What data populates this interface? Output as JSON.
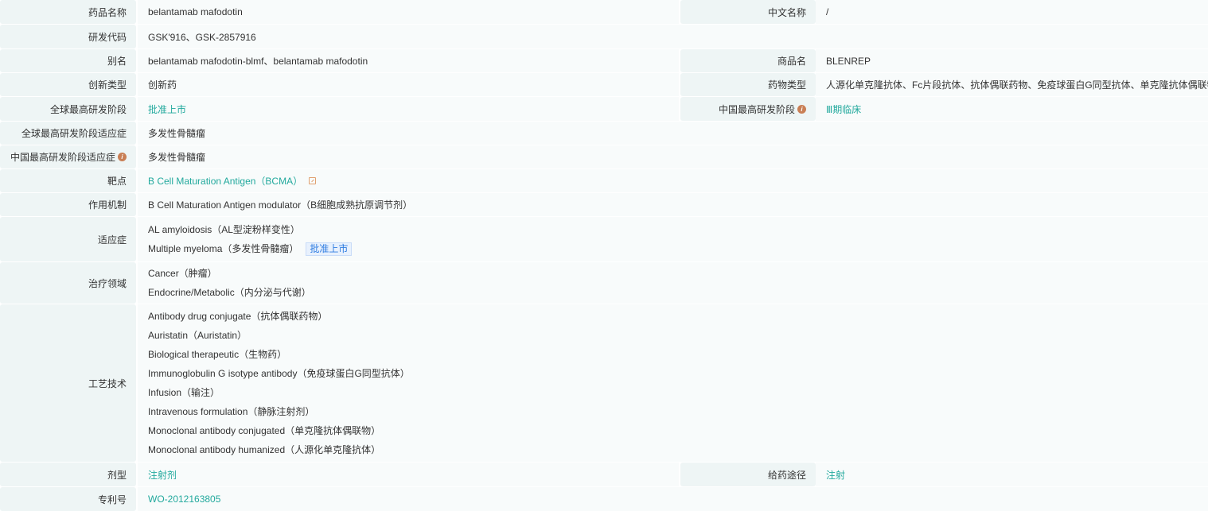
{
  "rows": {
    "drug_name": {
      "label": "药品名称",
      "value": "belantamab mafodotin"
    },
    "cn_name": {
      "label": "中文名称",
      "value": "/"
    },
    "code": {
      "label": "研发代码",
      "value": "GSK'916、GSK-2857916"
    },
    "alias": {
      "label": "别名",
      "value": "belantamab mafodotin-blmf、belantamab mafodotin"
    },
    "trade_name": {
      "label": "商品名",
      "value": "BLENREP"
    },
    "innovation": {
      "label": "创新类型",
      "value": "创新药"
    },
    "drug_type": {
      "label": "药物类型",
      "value": "人源化单克隆抗体、Fc片段抗体、抗体偶联药物、免疫球蛋白G同型抗体、单克隆抗体偶联物"
    },
    "global_phase": {
      "label": "全球最高研发阶段",
      "value": "批准上市"
    },
    "china_phase": {
      "label": "中国最高研发阶段",
      "value": "Ⅲ期临床"
    },
    "global_indication": {
      "label": "全球最高研发阶段适应症",
      "value": "多发性骨髓瘤"
    },
    "china_indication": {
      "label": "中国最高研发阶段适应症",
      "value": "多发性骨髓瘤"
    },
    "target": {
      "label": "靶点",
      "value": "B Cell Maturation Antigen（BCMA）"
    },
    "mechanism": {
      "label": "作用机制",
      "value": "B Cell Maturation Antigen modulator（B细胞成熟抗原调节剂）"
    },
    "indications": {
      "label": "适应症",
      "items": [
        "AL amyloidosis（AL型淀粉样变性）",
        "Multiple myeloma（多发性骨髓瘤）"
      ],
      "tag": "批准上市"
    },
    "therapy_area": {
      "label": "治疗领域",
      "items": [
        "Cancer（肿瘤）",
        "Endocrine/Metabolic（内分泌与代谢）"
      ]
    },
    "technology": {
      "label": "工艺技术",
      "items": [
        "Antibody drug conjugate（抗体偶联药物）",
        "Auristatin（Auristatin）",
        "Biological therapeutic（生物药）",
        "Immunoglobulin G isotype antibody（免疫球蛋白G同型抗体）",
        "Infusion（输注）",
        "Intravenous formulation（静脉注射剂）",
        "Monoclonal antibody conjugated（单克隆抗体偶联物）",
        "Monoclonal antibody humanized（人源化单克隆抗体）"
      ]
    },
    "dosage_form": {
      "label": "剂型",
      "value": "注射剂"
    },
    "route": {
      "label": "给药途径",
      "value": "注射"
    },
    "patent": {
      "label": "专利号",
      "value": "WO-2012163805"
    }
  },
  "colors": {
    "link": "#22a99d",
    "label_bg": "#eef5f5",
    "value_bg": "#f8fbfb",
    "info": "#c97f55"
  }
}
